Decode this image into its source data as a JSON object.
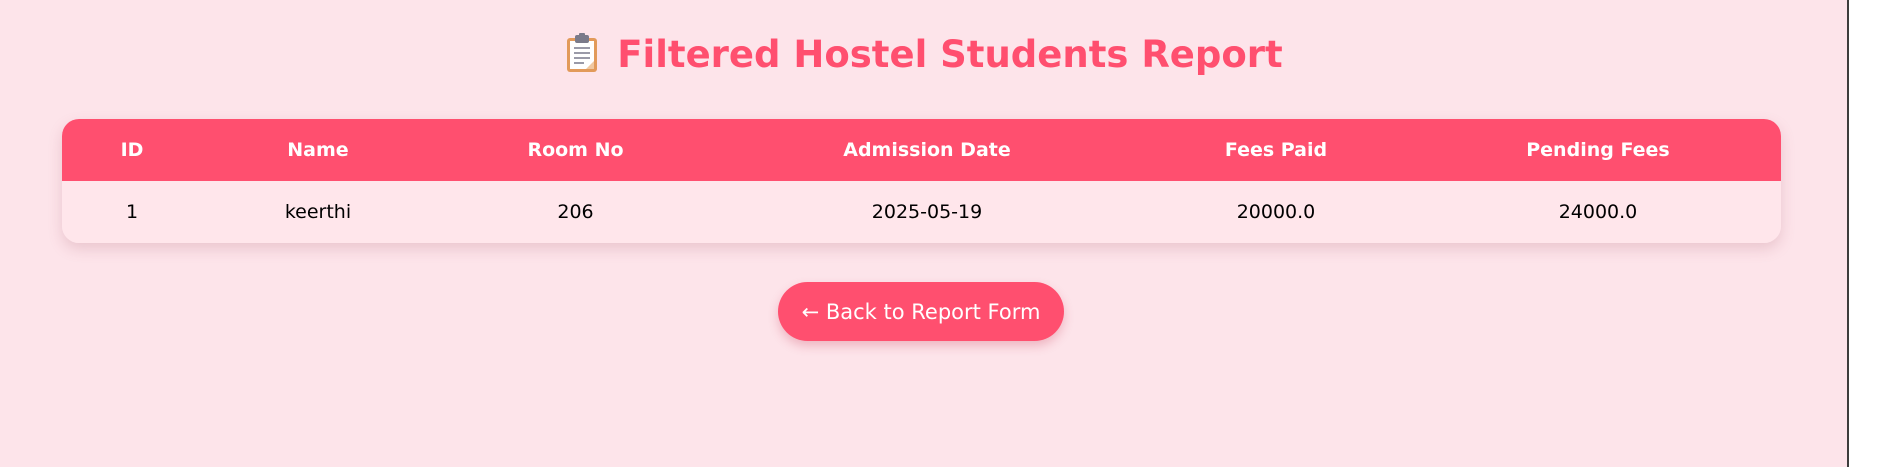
{
  "page": {
    "title": "Filtered Hostel Students Report",
    "title_icon": "clipboard-icon"
  },
  "table": {
    "headers": [
      "ID",
      "Name",
      "Room No",
      "Admission Date",
      "Fees Paid",
      "Pending Fees"
    ],
    "rows": [
      [
        "1",
        "keerthi",
        "206",
        "2025-05-19",
        "20000.0",
        "24000.0"
      ]
    ]
  },
  "actions": {
    "back_label": "← Back to Report Form"
  },
  "colors": {
    "background": "#fde4ea",
    "accent": "#ff4f6f",
    "row_background": "#ffe6eb",
    "header_text": "#ffffff"
  }
}
